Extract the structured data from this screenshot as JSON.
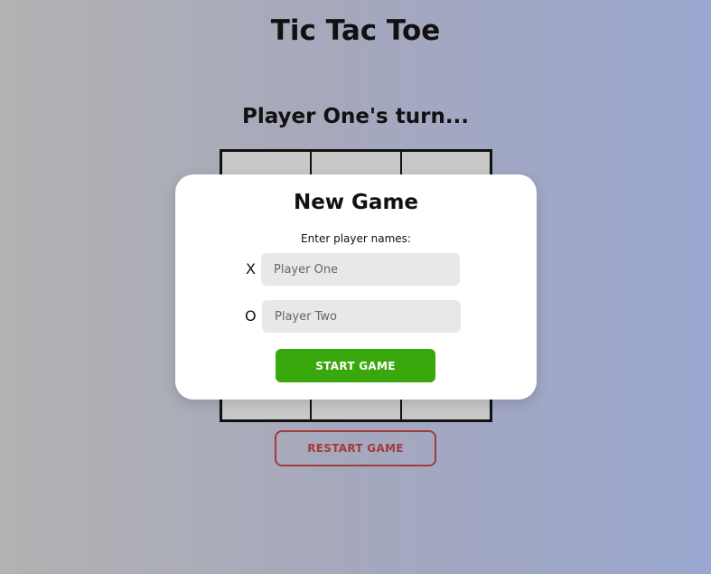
{
  "header": {
    "title": "Tic Tac Toe"
  },
  "status": {
    "turn_text": "Player One's turn..."
  },
  "board": {
    "cells": [
      "",
      "",
      "",
      "",
      "",
      "",
      "",
      "",
      ""
    ]
  },
  "controls": {
    "restart_label": "RESTART GAME"
  },
  "modal": {
    "title": "New Game",
    "subtitle": "Enter player names:",
    "players": [
      {
        "mark": "X",
        "placeholder": "Player One",
        "value": ""
      },
      {
        "mark": "O",
        "placeholder": "Player Two",
        "value": ""
      }
    ],
    "start_label": "START GAME"
  },
  "colors": {
    "start_button": "#38a80c",
    "restart_border": "#a33a3a",
    "board_cell": "#c8c8c8"
  }
}
